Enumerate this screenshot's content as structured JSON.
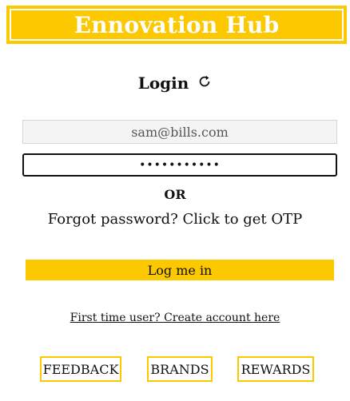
{
  "header": {
    "title": "Ennovation Hub"
  },
  "login": {
    "heading": "Login",
    "refresh_icon": "refresh-icon",
    "email_value": "sam@bills.com",
    "password_value": "•••••••••••",
    "or_label": "OR",
    "forgot_text": "Forgot password? Click to get OTP",
    "submit_label": "Log me in",
    "create_account_text": "First time user? Create account here"
  },
  "nav": {
    "feedback_label": "FEEDBACK",
    "brands_label": "BRANDS",
    "rewards_label": "REWARDS"
  },
  "colors": {
    "accent": "#fcc800",
    "text": "#111111"
  }
}
